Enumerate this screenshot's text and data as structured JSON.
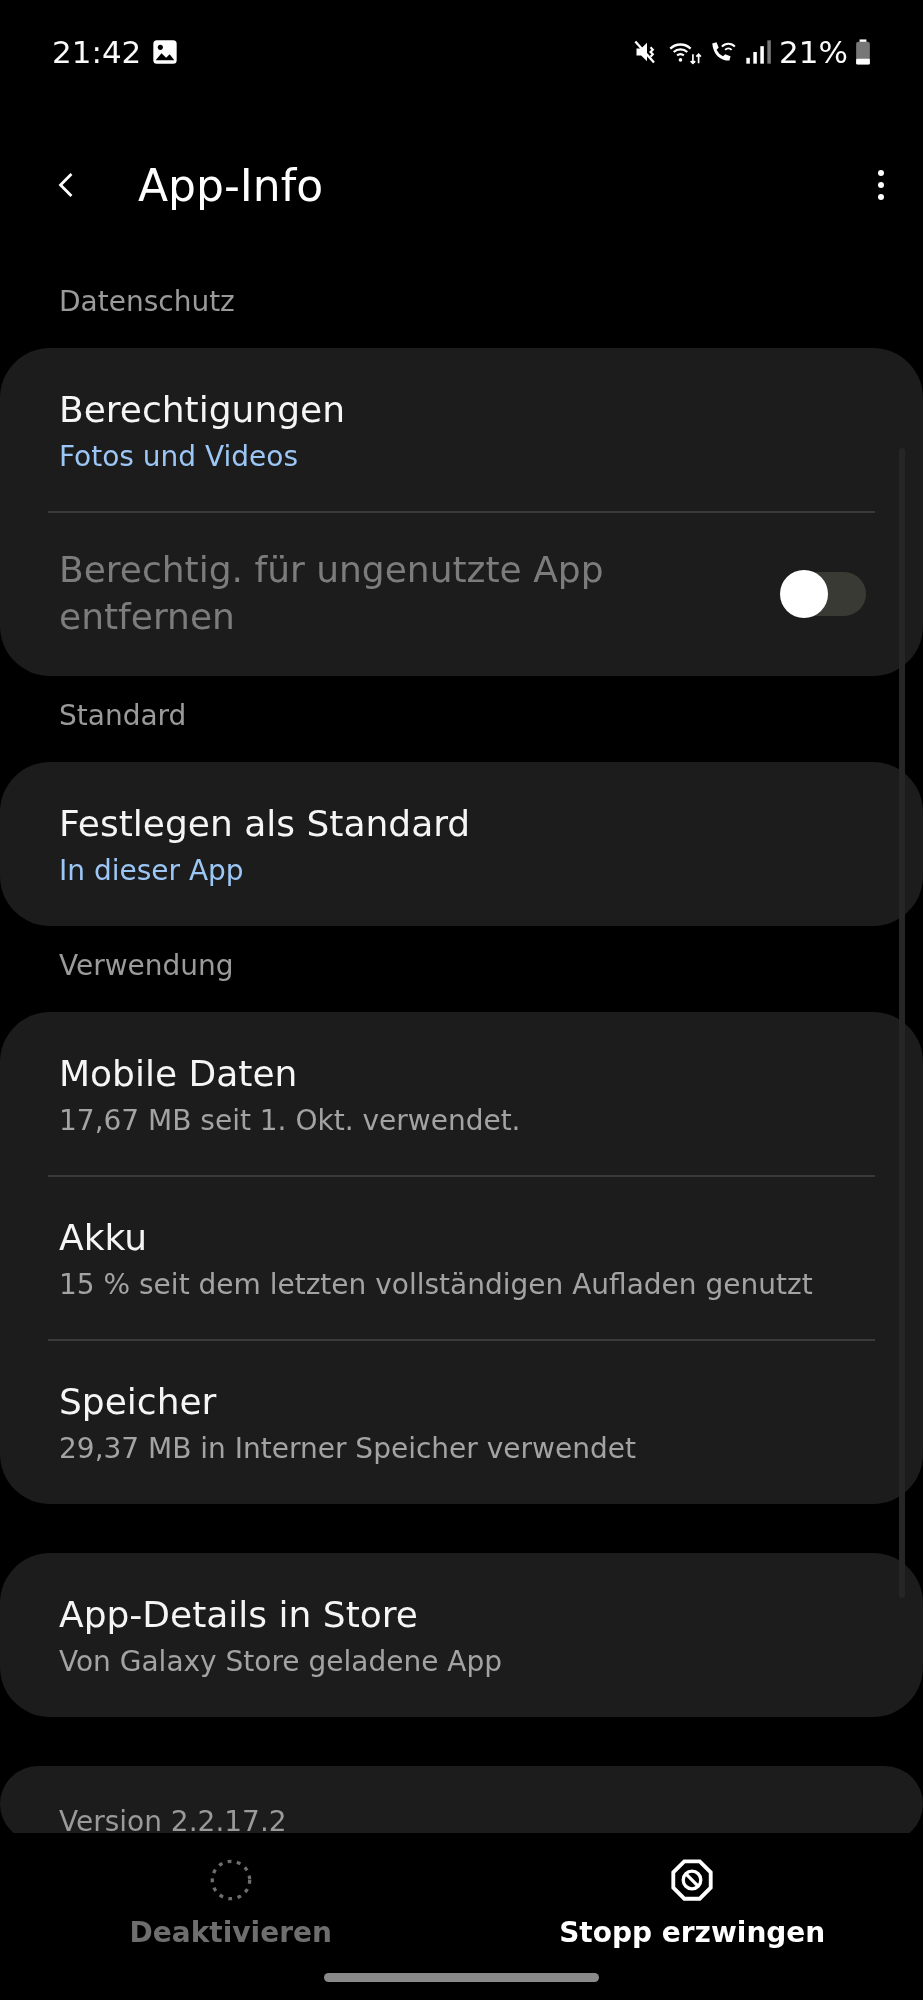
{
  "status_bar": {
    "time": "21:42",
    "battery": "21%"
  },
  "header": {
    "title": "App-Info"
  },
  "sections": [
    {
      "header": "Datenschutz",
      "items": [
        {
          "kind": "link",
          "title": "Berechtigungen",
          "subtitle": "Fotos und Videos",
          "accent": true
        },
        {
          "kind": "switch",
          "title": "Berechtig. für ungenutzte App entfernen",
          "disabled": true,
          "on": false
        }
      ]
    },
    {
      "header": "Standard",
      "items": [
        {
          "kind": "link",
          "title": "Festlegen als Standard",
          "subtitle": "In dieser App",
          "accent": true
        }
      ]
    },
    {
      "header": "Verwendung",
      "items": [
        {
          "kind": "link",
          "title": "Mobile Daten",
          "subtitle": "17,67 MB seit 1. Okt. verwendet.",
          "accent": false
        },
        {
          "kind": "link",
          "title": "Akku",
          "subtitle": "15 % seit dem letzten vollständigen Aufladen genutzt",
          "accent": false
        },
        {
          "kind": "link",
          "title": "Speicher",
          "subtitle": "29,37 MB in Interner Speicher verwendet",
          "accent": false
        }
      ]
    },
    {
      "items": [
        {
          "kind": "link",
          "title": "App-Details in Store",
          "subtitle": "Von Galaxy Store geladene App",
          "accent": false
        }
      ]
    }
  ],
  "version": "Version 2.2.17.2",
  "bottom_actions": [
    {
      "label": "Deaktivieren",
      "kind": "deactivate",
      "disabled": true
    },
    {
      "label": "Stopp erzwingen",
      "kind": "force-stop",
      "disabled": false
    }
  ]
}
